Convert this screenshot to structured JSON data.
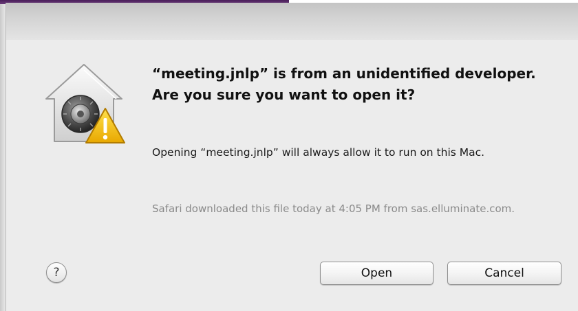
{
  "dialog": {
    "title": "“meeting.jnlp” is from an unidentified developer. Are you sure you want to open it?",
    "message": "Opening “meeting.jnlp” will always allow it to run on this Mac.",
    "source_note": "Safari downloaded this file today at 4:05 PM from sas.elluminate.com.",
    "icon": "gatekeeper-warning-icon",
    "help_label": "?",
    "buttons": {
      "open_label": "Open",
      "cancel_label": "Cancel"
    }
  },
  "colors": {
    "sheet_background": "#ececec",
    "secondary_text": "#8a8a8a",
    "warning_yellow": "#f5c400"
  }
}
